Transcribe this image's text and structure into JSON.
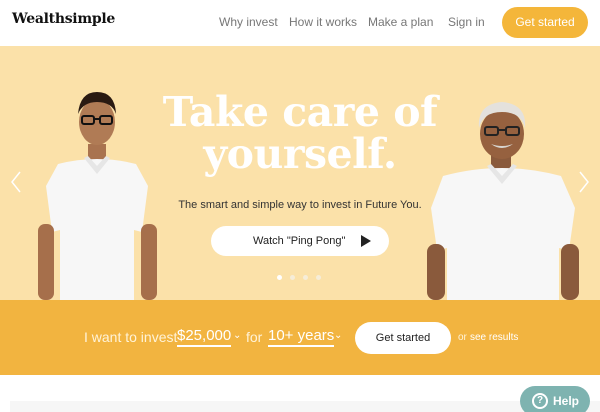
{
  "brand": {
    "logo_text": "Wealthsimple"
  },
  "nav": {
    "links": [
      "Why invest",
      "How it works",
      "Make a plan",
      "Sign in"
    ],
    "cta": "Get started"
  },
  "hero": {
    "headline": "Take care of yourself.",
    "subline": "The smart and simple way to invest in Future You.",
    "watch_label": "Watch \"Ping Pong\"",
    "slide_count": 4,
    "active_slide": 1
  },
  "invest_form": {
    "prefix": "I want to invest",
    "amount": "$25,000",
    "for_label": "for",
    "duration": "10+ years",
    "cta": "Get started",
    "or_text": "or",
    "see_results": "see results"
  },
  "help": {
    "label": "Help",
    "icon": "question-mark-icon"
  },
  "colors": {
    "accent": "#f4b63a",
    "hero_bg": "#fbe1a9",
    "band_bg": "#f2b440",
    "help_bg": "#7eb3b0"
  }
}
